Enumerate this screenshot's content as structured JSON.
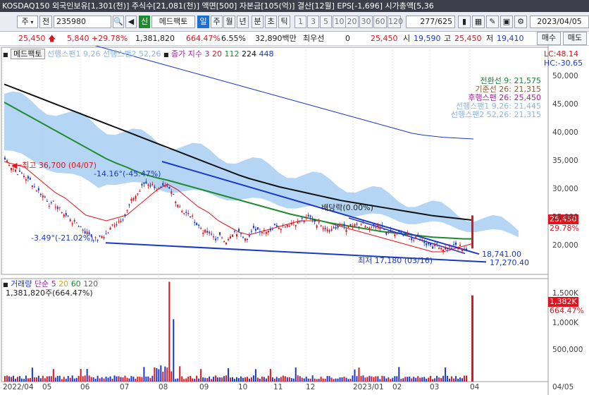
{
  "titlebar": {
    "text": "KOSDAQ150 외국인보유[1,301(천)]  주식수[21,081(천)]  액면[500]  자본금[105(억)]  결산[12월]  EPS[-1,696]  시가총액[5,36"
  },
  "toolbar": {
    "market_select": "주",
    "jeon_label": "전",
    "code": "235980",
    "sin_label": "신",
    "stock_name": "메드팩토",
    "periods": [
      "일",
      "주",
      "월",
      "년",
      "분",
      "초",
      "틱"
    ],
    "active_period": "일",
    "intervals": [
      "1",
      "3",
      "5",
      "10",
      "20",
      "30",
      "60",
      "120"
    ],
    "counter": "277",
    "counter_total": "/625",
    "date": "2023/04/05"
  },
  "quote": {
    "price": "25,450",
    "change": "5,840",
    "change_pct": "+29.78%",
    "volume": "1,381,820",
    "volume_pct": "664.47%",
    "turnover": "6.55%",
    "amount": "32,890백만",
    "min_line_label": "최우선",
    "min_line_value": "0",
    "last": "25,450",
    "open_label": "시",
    "open": "19,590",
    "high_label": "고",
    "high": "25,450",
    "low_label": "저",
    "low": "19,410"
  },
  "price_panel": {
    "stock_tag": "메드팩토",
    "span1_label": "선행스팬1 9,26",
    "span2_label": "선행스팬2 52,26",
    "ma_label": "종가 지수 3",
    "ma_periods": [
      "20",
      "112",
      "224",
      "448"
    ],
    "lc": "LC:48.14",
    "hc": "HC:-30.65",
    "ichimoku_values": [
      {
        "text": "전환선 9: 21,575",
        "color": "#1f7f3a"
      },
      {
        "text": "기준선 26: 21,315",
        "color": "#8c5b2e"
      },
      {
        "text": "후행스팬 26: 25,450",
        "color": "#9b2a9b"
      },
      {
        "text": "선행스팬1 9,26: 21,445",
        "color": "#8fb4e0"
      },
      {
        "text": "선행스팬2 52,26: 21,315",
        "color": "#8fb4e0"
      }
    ],
    "high_annot": "최고 36,700 (04/07)",
    "low_annot": "최저 17,180 (03/16)",
    "angle_top": "-14.16°(-45.47%)",
    "angle_bottom": "-3.49°(-21.02%)",
    "dividend_label": "배당락(0.00%)",
    "trend_value_1": "18,741.00",
    "trend_value_2": "17,270.40",
    "current_price_tag": "25,450",
    "current_pct_tag": "29.78%"
  },
  "volume_panel": {
    "title": "거래량",
    "ma_label": "단순 5",
    "ma_periods": [
      "20",
      "60",
      "120"
    ],
    "value": "1,381,820주(664.47%)",
    "current_tag": "1,382K",
    "current_pct": "664.47%"
  },
  "price_axis": {
    "ticks": [
      "50,000",
      "45,000",
      "40,000",
      "35,000",
      "30,000",
      "25,000",
      "20,000"
    ]
  },
  "volume_axis": {
    "ticks": [
      "1,500K",
      "1,000K",
      "500,000"
    ]
  },
  "x_axis": {
    "ticks": [
      "2022/04",
      "05",
      "06",
      "07",
      "08",
      "09",
      "10",
      "11",
      "12",
      "2023/01",
      "02",
      "03",
      "04"
    ],
    "right_label": "04/05"
  },
  "colors": {
    "up": "#e0141e",
    "down": "#1b39c8",
    "cloud": "#a7cff2",
    "ma20": "#e0141e",
    "ma112": "#1f8a2f",
    "ma224": "#111111",
    "ma448": "#1b39c8"
  },
  "chart_data": {
    "type": "candlestick",
    "ma_lines": [
      {
        "name": "20",
        "values": [
          35000,
          34500,
          34000,
          32500,
          31000,
          29500,
          28500,
          27000,
          25500,
          25000,
          24500,
          25000,
          25500,
          27000,
          28500,
          30000,
          31000,
          30000,
          28500,
          27000,
          26000,
          24500,
          23500,
          22500,
          22000,
          22500,
          23000,
          23500,
          24000,
          24500,
          24500,
          24500,
          24000,
          23500,
          23000,
          22500,
          22000,
          21500,
          21000,
          20500,
          20000,
          19500,
          19000,
          19000,
          19500,
          20000,
          20500
        ]
      },
      {
        "name": "112",
        "values": [
          45500,
          44500,
          43500,
          42500,
          41500,
          40500,
          39500,
          38500,
          37500,
          36500,
          35500,
          34700,
          34000,
          33200,
          32600,
          32100,
          31700,
          31200,
          30700,
          30200,
          29700,
          29200,
          28700,
          28200,
          27700,
          27200,
          26700,
          26200,
          25700,
          25300,
          24900,
          24500,
          24100,
          23800,
          23500,
          23200,
          22900,
          22600,
          22400,
          22200,
          22000,
          21800,
          21600,
          21500,
          21400,
          21300,
          21300
        ]
      },
      {
        "name": "224",
        "values": [
          48700,
          48000,
          47300,
          46600,
          45900,
          45200,
          44500,
          43800,
          43100,
          42400,
          41700,
          41000,
          40300,
          39600,
          38900,
          38200,
          37500,
          36800,
          36100,
          35400,
          34700,
          34000,
          33300,
          32600,
          32000,
          31500,
          31000,
          30500,
          30100,
          29700,
          29300,
          28900,
          28500,
          28100,
          27800,
          27500,
          27200,
          26900,
          26600,
          26300,
          26000,
          25700,
          25400,
          25200,
          25000,
          24800,
          24600
        ]
      },
      {
        "name": "448",
        "values": [
          60000,
          59500,
          59000,
          58500,
          58000,
          57500,
          57000,
          56500,
          56000,
          55500,
          55000,
          54500,
          54000,
          53500,
          53000,
          52500,
          52000,
          51500,
          51000,
          50500,
          50000,
          49500,
          49000,
          48500,
          48000,
          47500,
          47000,
          46500,
          46000,
          45500,
          45000,
          44500,
          44000,
          43500,
          43000,
          42500,
          42000,
          41500,
          41000,
          40500,
          40000,
          39700,
          39500,
          39300,
          39200,
          39100,
          39000
        ]
      }
    ],
    "y_range": [
      15500,
      55500
    ]
  }
}
